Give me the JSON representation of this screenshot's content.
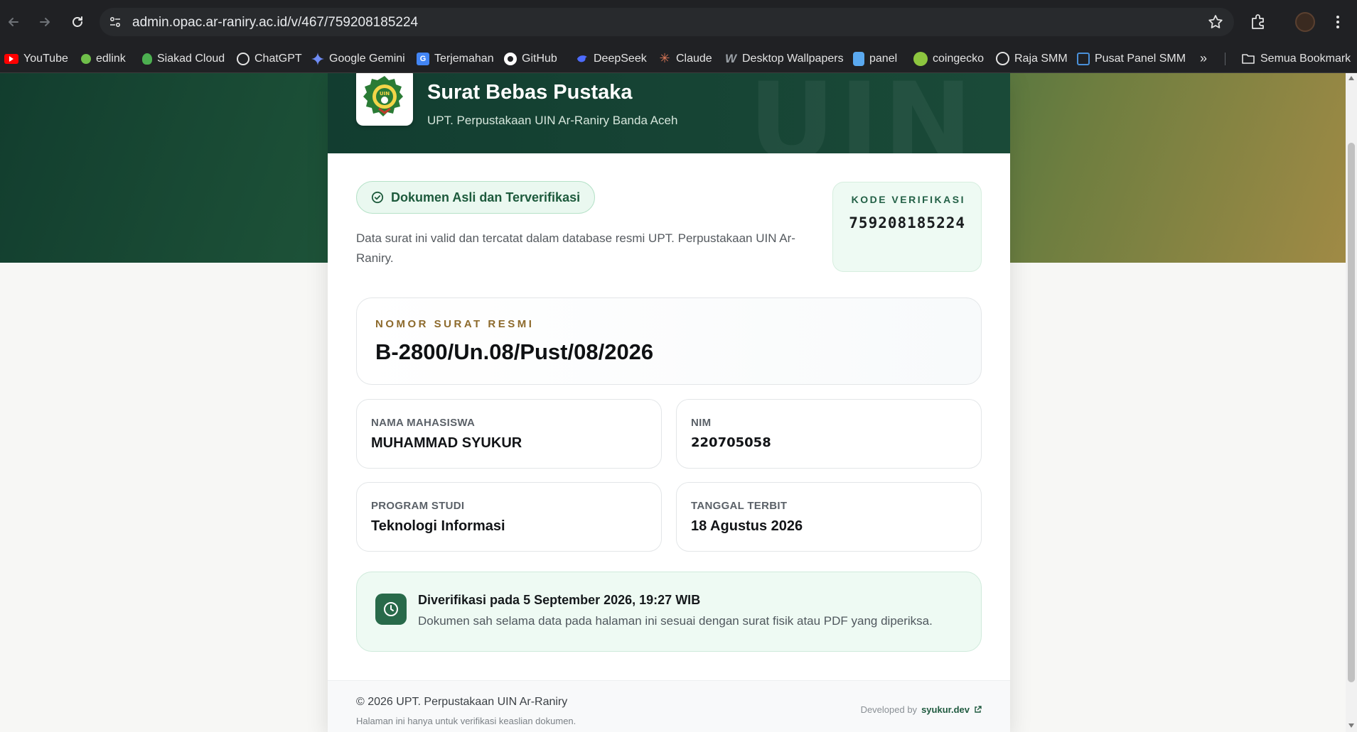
{
  "browser": {
    "url": "admin.opac.ar-raniry.ac.id/v/467/759208185224",
    "bookmarks": [
      {
        "label": "YouTube",
        "icon": "youtube-icon",
        "color": "#ff0000"
      },
      {
        "label": "edlink",
        "icon": "edlink-icon",
        "color": "#6fbf4a"
      },
      {
        "label": "Siakad Cloud",
        "icon": "siakad-icon",
        "color": "#4caf50"
      },
      {
        "label": "ChatGPT",
        "icon": "chatgpt-icon",
        "color": "#ffffff"
      },
      {
        "label": "Google Gemini",
        "icon": "gemini-icon",
        "color": "#6f8cf5"
      },
      {
        "label": "Terjemahan",
        "icon": "translate-icon",
        "color": "#4285f4"
      },
      {
        "label": "GitHub",
        "icon": "github-icon",
        "color": "#ffffff"
      },
      {
        "label": "DeepSeek",
        "icon": "deepseek-icon",
        "color": "#4d6bfe"
      },
      {
        "label": "Claude",
        "icon": "claude-icon",
        "color": "#d97757"
      },
      {
        "label": "Desktop Wallpapers",
        "icon": "wallpapers-icon",
        "color": "#9aa0a6"
      },
      {
        "label": "panel",
        "icon": "panel-icon",
        "color": "#5aa9f0"
      },
      {
        "label": "coingecko",
        "icon": "coingecko-icon",
        "color": "#8dc63f"
      },
      {
        "label": "Raja SMM",
        "icon": "rajasmm-icon",
        "color": "#ffffff"
      },
      {
        "label": "Pusat Panel SMM",
        "icon": "pusatpanel-icon",
        "color": "#4a90d9"
      }
    ],
    "more_label": "»",
    "all_bookmarks_label": "Semua Bookmark"
  },
  "header": {
    "title": "Surat Bebas Pustaka",
    "subtitle": "UPT. Perpustakaan UIN Ar-Raniry Banda Aceh",
    "watermark": "UIN",
    "logo_text": "UIN"
  },
  "status": {
    "badge": "Dokumen Asli dan Terverifikasi",
    "description": "Data surat ini valid dan tercatat dalam database resmi UPT. Perpustakaan UIN Ar-Raniry."
  },
  "verification": {
    "label": "KODE VERIFIKASI",
    "code": "759208185224"
  },
  "letter": {
    "number_label": "NOMOR SURAT RESMI",
    "number": "B-2800/Un.08/Pust/08/2026"
  },
  "fields": {
    "name": {
      "label": "NAMA MAHASISWA",
      "value": "MUHAMMAD SYUKUR"
    },
    "nim": {
      "label": "NIM",
      "value": "220705058"
    },
    "program": {
      "label": "PROGRAM STUDI",
      "value": "Teknologi Informasi"
    },
    "date": {
      "label": "TANGGAL TERBIT",
      "value": "18 Agustus 2026"
    }
  },
  "notice": {
    "title": "Diverifikasi pada 5 September 2026, 19:27 WIB",
    "text": "Dokumen sah selama data pada halaman ini sesuai dengan surat fisik atau PDF yang diperiksa."
  },
  "footer": {
    "copyright": "© 2026 UPT. Perpustakaan UIN Ar-Raniry",
    "note": "Halaman ini hanya untuk verifikasi keaslian dokumen.",
    "developed_by": "Developed by",
    "developer": "syukur.dev"
  },
  "colors": {
    "brand_dark": "#123d30",
    "accent_gold": "#8d6a2c",
    "success_bg": "#eefaf3"
  }
}
